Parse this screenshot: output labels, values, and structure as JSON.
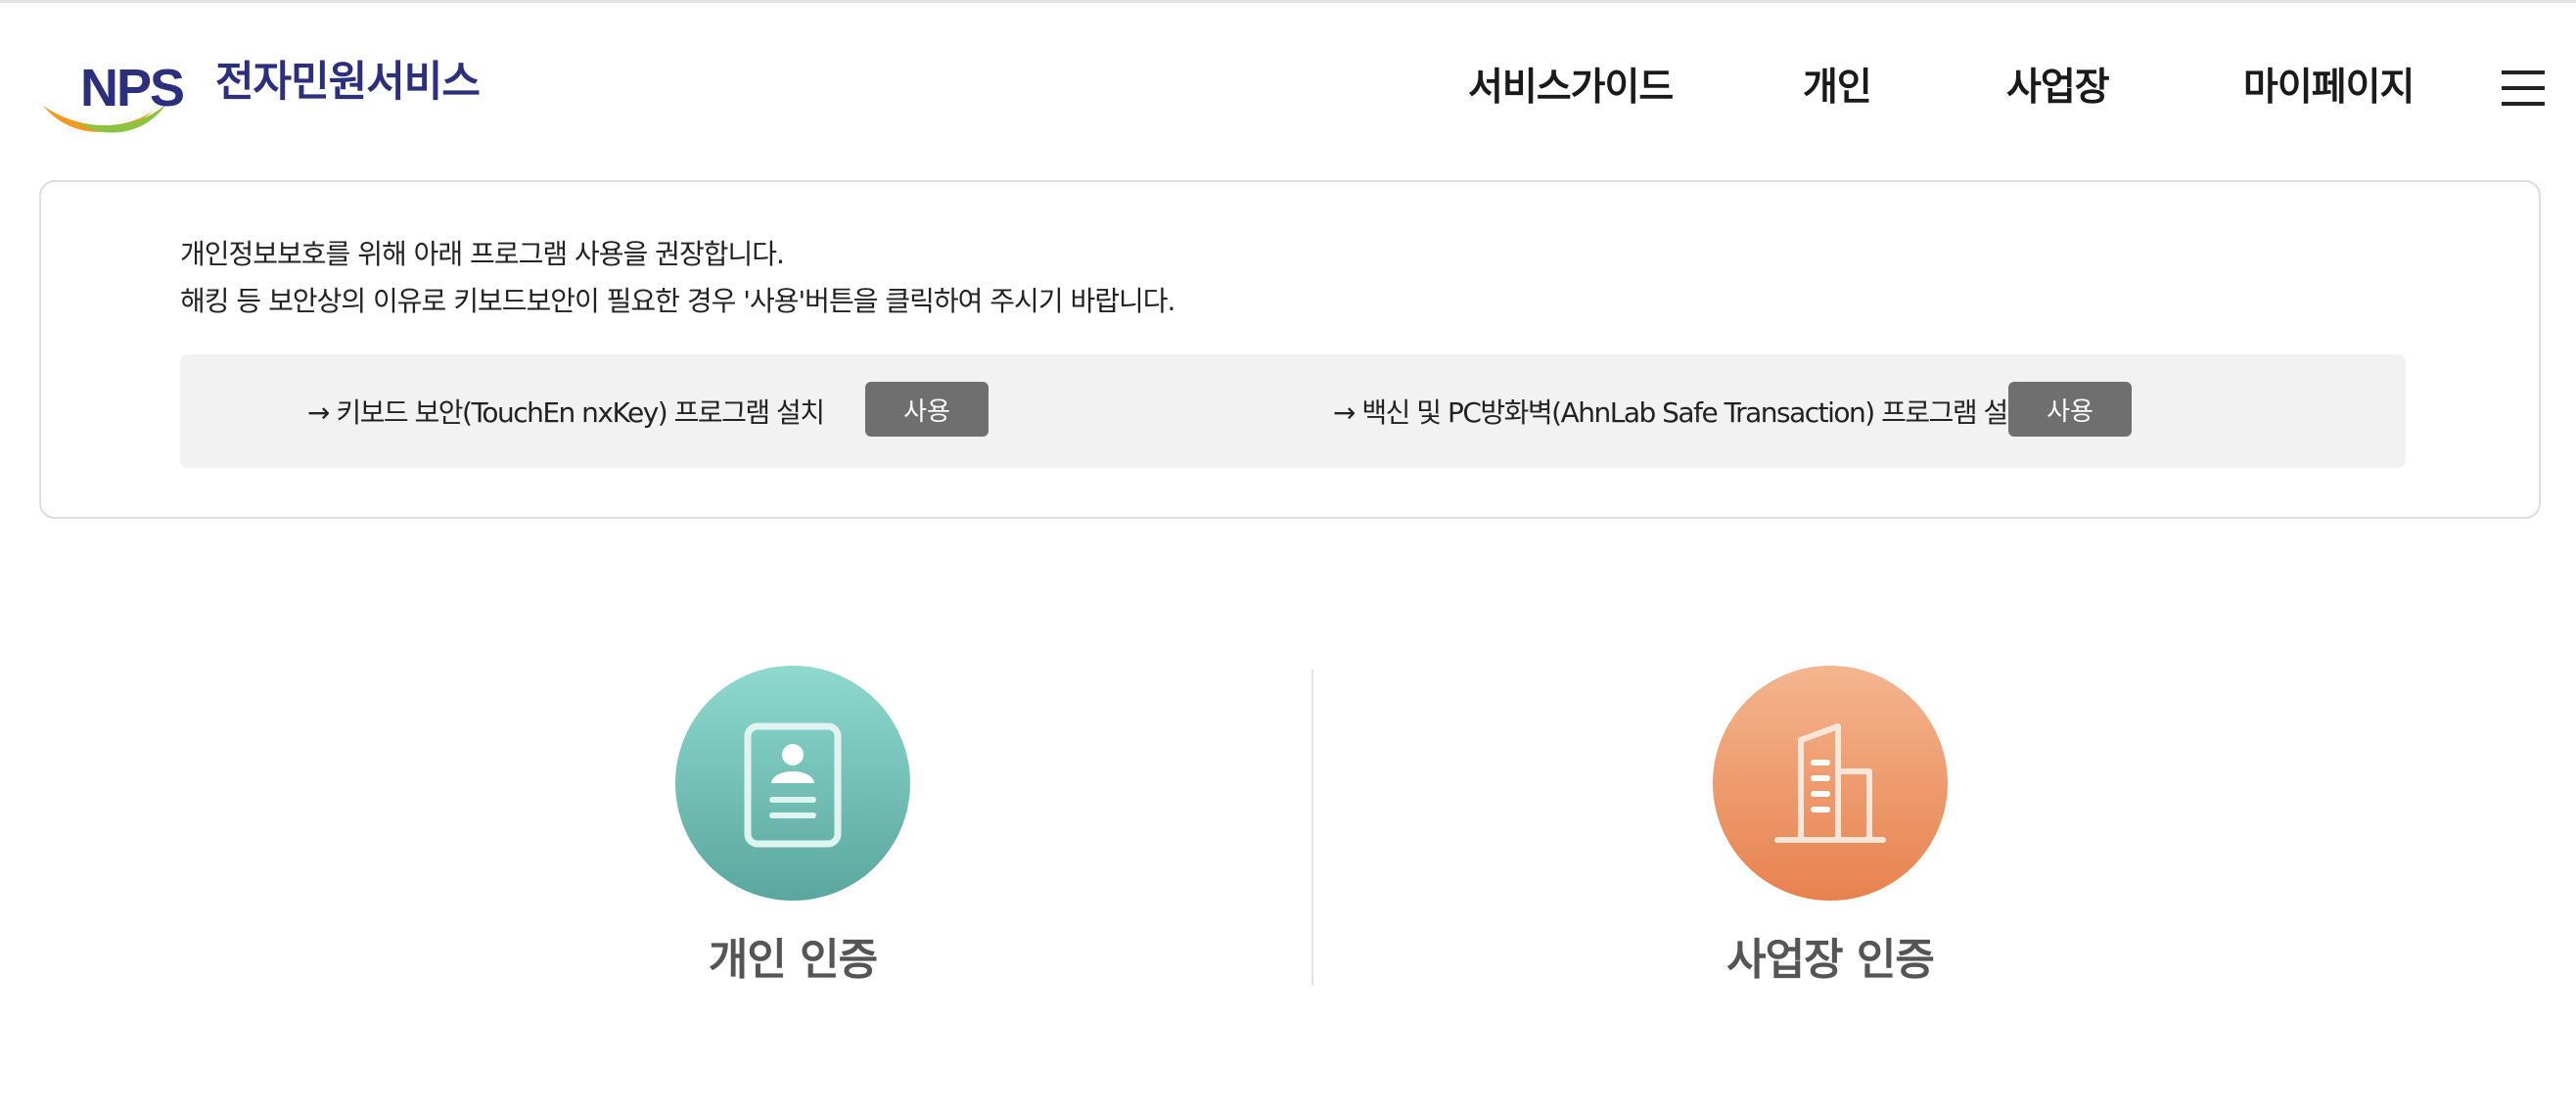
{
  "header": {
    "logo_text": "NPS",
    "logo_title": "전자민원서비스",
    "nav": [
      {
        "label": "서비스가이드"
      },
      {
        "label": "개인"
      },
      {
        "label": "사업장"
      },
      {
        "label": "마이페이지"
      }
    ],
    "menu_icon": "hamburger-icon"
  },
  "notice": {
    "line1": "개인정보보호를 위해 아래 프로그램 사용을 권장합니다.",
    "line2": "해킹 등 보안상의 이유로 키보드보안이 필요한 경우 '사용'버튼을 클릭하여 주시기 바랍니다.",
    "programs": [
      {
        "label": "→ 키보드 보안(TouchEn nxKey) 프로그램 설치",
        "button": "사용"
      },
      {
        "label": "→ 백신 및 PC방화벽(AhnLab Safe Transaction) 프로그램 설치",
        "button": "사용"
      }
    ]
  },
  "auth": {
    "personal": {
      "label": "개인 인증",
      "icon": "id-card-icon"
    },
    "business": {
      "label": "사업장 인증",
      "icon": "building-icon"
    }
  },
  "colors": {
    "brand_navy": "#2b2f7e",
    "personal_gradient_top": "#8fd9ce",
    "personal_gradient_bottom": "#5aa79f",
    "business_gradient_top": "#f4b58f",
    "business_gradient_bottom": "#e8824f",
    "button_gray": "#6f6f6f"
  }
}
